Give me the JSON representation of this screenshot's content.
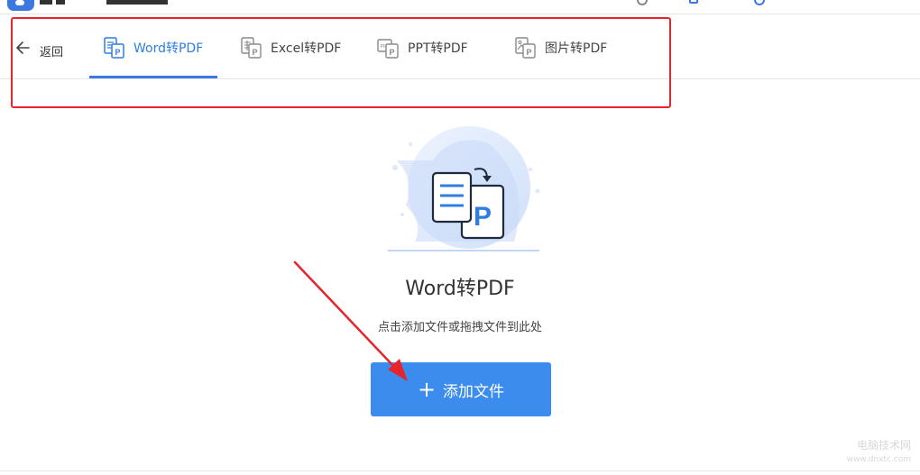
{
  "tabs": [
    {
      "label": "Word转PDF",
      "icon": "word-file-icon",
      "active": true
    },
    {
      "label": "Excel转PDF",
      "icon": "excel-file-icon",
      "active": false
    },
    {
      "label": "PPT转PDF",
      "icon": "ppt-file-icon",
      "active": false
    },
    {
      "label": "图片转PDF",
      "icon": "image-file-icon",
      "active": false
    }
  ],
  "back_label": "返回",
  "main": {
    "title": "Word转PDF",
    "hint": "点击添加文件或拖拽文件到此处",
    "add_button_label": "添加文件"
  },
  "watermark": {
    "line1": "电脑技术网",
    "line2": "www.dnxtc.com"
  },
  "colors": {
    "accent": "#3b78e0",
    "button": "#3b8ced",
    "annotation": "#e5242b"
  }
}
